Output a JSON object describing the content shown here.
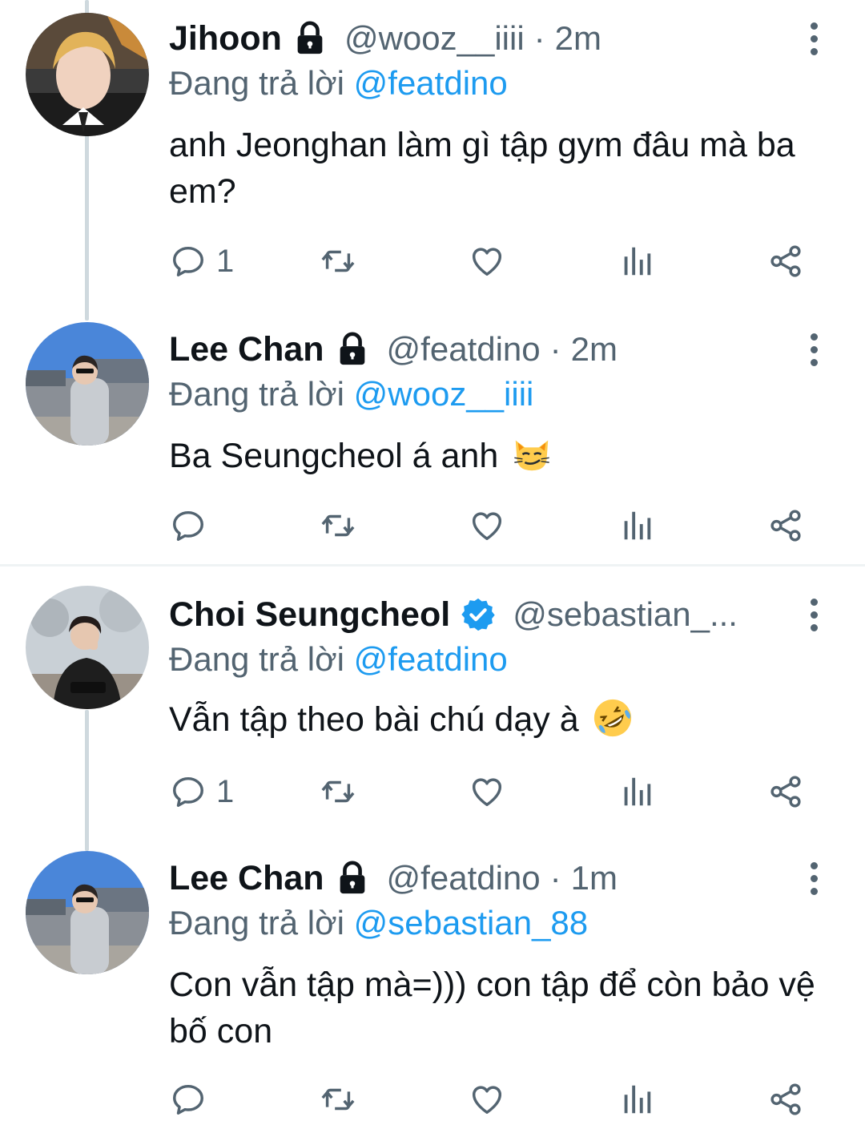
{
  "tweets": [
    {
      "name": "Jihoon",
      "badge": "lock-icon",
      "handle": "@wooz__iiii",
      "separator": "·",
      "time": "2m",
      "reply_prefix": "Đang trả lời",
      "reply_to": "@featdino",
      "text": "anh Jeonghan làm gì tập gym đâu mà ba em?",
      "reply_count": "1"
    },
    {
      "name": "Lee Chan",
      "badge": "lock-icon",
      "handle": "@featdino",
      "separator": "·",
      "time": "2m",
      "reply_prefix": "Đang trả lời",
      "reply_to": "@wooz__iiii",
      "text": "Ba Seungcheol á anh",
      "emoji": "smirking-cat-emoji",
      "reply_count": ""
    },
    {
      "name": "Choi Seungcheol",
      "badge": "verified-badge-icon",
      "handle": "@sebastian_...",
      "separator": "",
      "time": "",
      "reply_prefix": "Đang trả lời",
      "reply_to": "@featdino",
      "text": "Vẫn tập theo bài chú dạy à",
      "emoji": "rolling-on-floor-laughing-emoji",
      "reply_count": "1"
    },
    {
      "name": "Lee Chan",
      "badge": "lock-icon",
      "handle": "@featdino",
      "separator": "·",
      "time": "1m",
      "reply_prefix": "Đang trả lời",
      "reply_to": "@sebastian_88",
      "text": "Con vẫn tập mà=))) con tập để còn bảo vệ bố con",
      "reply_count": ""
    }
  ],
  "icons": {
    "reply": "reply-bubble-icon",
    "retweet": "retweet-icon",
    "like": "heart-icon",
    "views": "analytics-icon",
    "share": "share-icon",
    "more": "more-vertical-icon"
  },
  "colors": {
    "link": "#1d9bf0",
    "secondary": "#536471",
    "thread_line": "#cfd9de",
    "verified": "#1d9bf0"
  }
}
